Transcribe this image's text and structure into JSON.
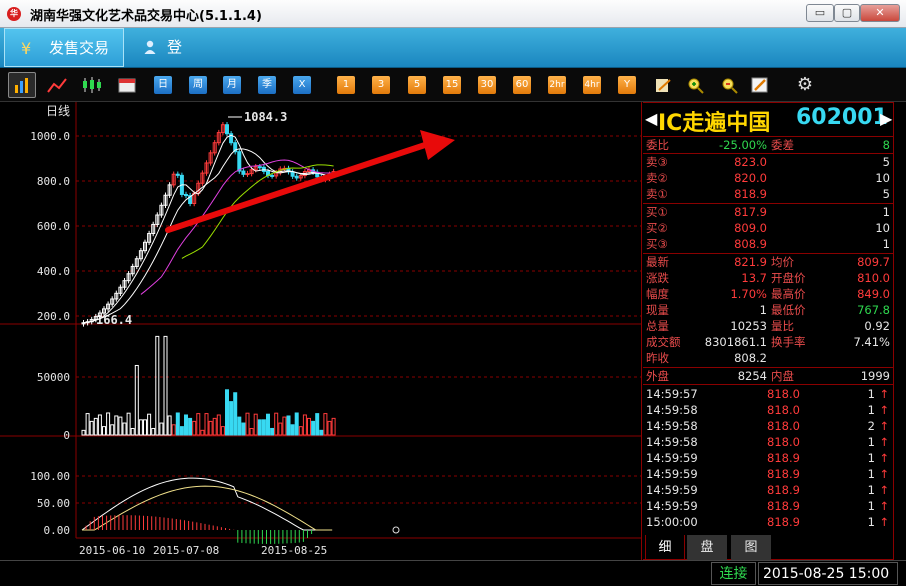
{
  "window": {
    "title": "湖南华强文化艺术品交易中心(5.1.1.4)",
    "logo": "华",
    "min": "▭",
    "max": "▢",
    "close": "✕"
  },
  "topbar": {
    "tab_sell": "发售交易",
    "login": "登 录"
  },
  "toolbar": {
    "blue_tools": [
      "日",
      "周",
      "月",
      "季",
      "X"
    ],
    "orange_tools": [
      "1",
      "3",
      "5",
      "15",
      "30",
      "60",
      "2hr",
      "4hr",
      "Y"
    ]
  },
  "chart": {
    "period_label": "日线",
    "price_ticks": [
      "1000.0",
      "800.0",
      "600.0",
      "400.0",
      "200.0"
    ],
    "high_label": "1084.3",
    "low_label": "166.4",
    "volume_ticks": [
      "50000",
      "0"
    ],
    "macd_ticks": [
      "100.00",
      "50.00",
      "0.00"
    ],
    "date_labels": [
      "2015-06-10",
      "2015-07-08",
      "2015-08-25"
    ]
  },
  "chart_data": {
    "type": "candlestick",
    "price_axis": {
      "ticks": [
        1000,
        800,
        600,
        400,
        200
      ],
      "range": [
        160,
        1110
      ]
    },
    "high": 1084.3,
    "low": 166.4,
    "volume_axis": {
      "ticks": [
        50000,
        0
      ]
    },
    "macd_axis": {
      "ticks": [
        100,
        50,
        0
      ]
    },
    "x_labels": [
      "2015-06-10",
      "2015-07-08",
      "2015-08-25"
    ]
  },
  "quote": {
    "name": "IC走遍中国",
    "code": "602001",
    "weibi_label": "委比",
    "weibi": "-25.00%",
    "weicha_label": "委差",
    "weicha": "8",
    "asks": [
      {
        "label": "卖③",
        "price": "823.0",
        "vol": "5"
      },
      {
        "label": "卖②",
        "price": "820.0",
        "vol": "10"
      },
      {
        "label": "卖①",
        "price": "818.9",
        "vol": "5"
      }
    ],
    "bids": [
      {
        "label": "买①",
        "price": "817.9",
        "vol": "1"
      },
      {
        "label": "买②",
        "price": "809.0",
        "vol": "10"
      },
      {
        "label": "买③",
        "price": "808.9",
        "vol": "1"
      }
    ],
    "stats": [
      {
        "l": "最新",
        "v": "821.9",
        "c": "red",
        "l2": "均价",
        "v2": "809.7",
        "c2": "red"
      },
      {
        "l": "涨跌",
        "v": "13.7",
        "c": "red",
        "l2": "开盘价",
        "v2": "810.0",
        "c2": "red"
      },
      {
        "l": "幅度",
        "v": "1.70%",
        "c": "red",
        "l2": "最高价",
        "v2": "849.0",
        "c2": "red"
      },
      {
        "l": "现量",
        "v": "1",
        "c": "white",
        "l2": "最低价",
        "v2": "767.8",
        "c2": "green"
      },
      {
        "l": "总量",
        "v": "10253",
        "c": "white",
        "l2": "量比",
        "v2": "0.92",
        "c2": "white"
      },
      {
        "l": "成交额",
        "v": "8301861.1",
        "c": "white",
        "l2": "换手率",
        "v2": "7.41%",
        "c2": "white"
      },
      {
        "l": "昨收",
        "v": "808.2",
        "c": "white",
        "l2": "",
        "v2": "",
        "c2": "white"
      }
    ],
    "outer_label": "外盘",
    "outer": "8254",
    "inner_label": "内盘",
    "inner": "1999",
    "ticks": [
      {
        "t": "14:59:57",
        "p": "818.0",
        "q": "1"
      },
      {
        "t": "14:59:58",
        "p": "818.0",
        "q": "1"
      },
      {
        "t": "14:59:58",
        "p": "818.0",
        "q": "2"
      },
      {
        "t": "14:59:58",
        "p": "818.0",
        "q": "1"
      },
      {
        "t": "14:59:59",
        "p": "818.9",
        "q": "1"
      },
      {
        "t": "14:59:59",
        "p": "818.9",
        "q": "1"
      },
      {
        "t": "14:59:59",
        "p": "818.9",
        "q": "1"
      },
      {
        "t": "14:59:59",
        "p": "818.9",
        "q": "1"
      },
      {
        "t": "15:00:00",
        "p": "818.9",
        "q": "1"
      }
    ],
    "tick_arrow": "↑"
  },
  "bottom_tabs": [
    "细",
    "盘",
    "图"
  ],
  "status": {
    "conn": "连接",
    "time": "2015-08-25 15:00"
  },
  "colors": {
    "up": "#ff3b3b",
    "down": "#2fd84f",
    "grid": "#8a0000",
    "accent": "#1a86bf"
  }
}
